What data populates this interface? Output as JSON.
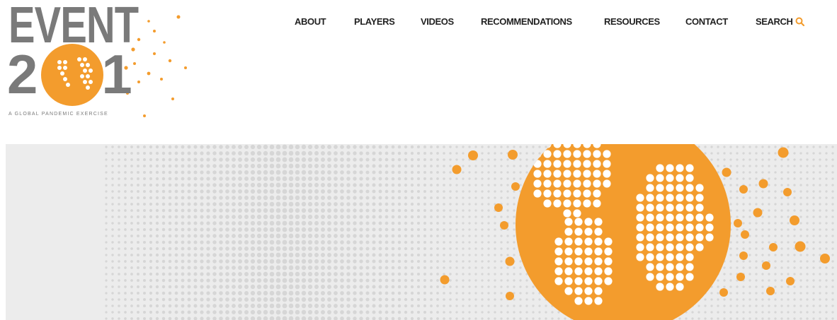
{
  "brand": {
    "word": "EVENT",
    "number_left": "2",
    "number_right": "1",
    "tagline": "A GLOBAL PANDEMIC EXERCISE",
    "gray": "#7a7a7a",
    "accent": "#f39c2d"
  },
  "nav": {
    "items": [
      {
        "label": "ABOUT"
      },
      {
        "label": "PLAYERS"
      },
      {
        "label": "VIDEOS"
      },
      {
        "label": "RECOMMENDATIONS"
      },
      {
        "label": "RESOURCES"
      },
      {
        "label": "CONTACT"
      }
    ],
    "search_label": "SEARCH",
    "search_icon": "magnifier-icon"
  },
  "hero": {
    "background": "#f0f0f0",
    "dot_color": "#d2d2d2",
    "globe_color": "#f39c2d"
  }
}
